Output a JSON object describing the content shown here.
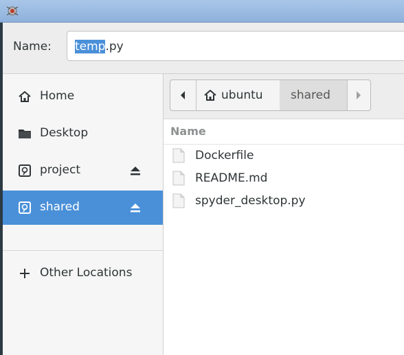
{
  "window": {
    "icon": "spyder-app-icon"
  },
  "name_field": {
    "label": "Name:",
    "selected_part": "temp",
    "rest_part": ".py"
  },
  "sidebar": {
    "items": [
      {
        "label": "Home",
        "icon": "home-icon"
      },
      {
        "label": "Desktop",
        "icon": "folder-icon"
      },
      {
        "label": "project",
        "icon": "drive-icon",
        "eject": true
      },
      {
        "label": "shared",
        "icon": "drive-icon",
        "eject": true,
        "selected": true
      },
      {
        "label": "Other Locations",
        "icon": "plus-icon"
      }
    ]
  },
  "pathbar": {
    "back_icon": "chevron-left-icon",
    "segments": [
      {
        "label": "ubuntu",
        "icon": "home-icon"
      },
      {
        "label": "shared",
        "active": true
      }
    ],
    "forward_icon": "chevron-right-icon"
  },
  "file_list": {
    "column_header": "Name",
    "files": [
      {
        "name": "Dockerfile",
        "icon": "text-file-icon"
      },
      {
        "name": "README.md",
        "icon": "text-file-icon"
      },
      {
        "name": "spyder_desktop.py",
        "icon": "text-file-icon"
      }
    ]
  },
  "colors": {
    "accent": "#4a90d9",
    "titlebar": "#9dbce2"
  }
}
